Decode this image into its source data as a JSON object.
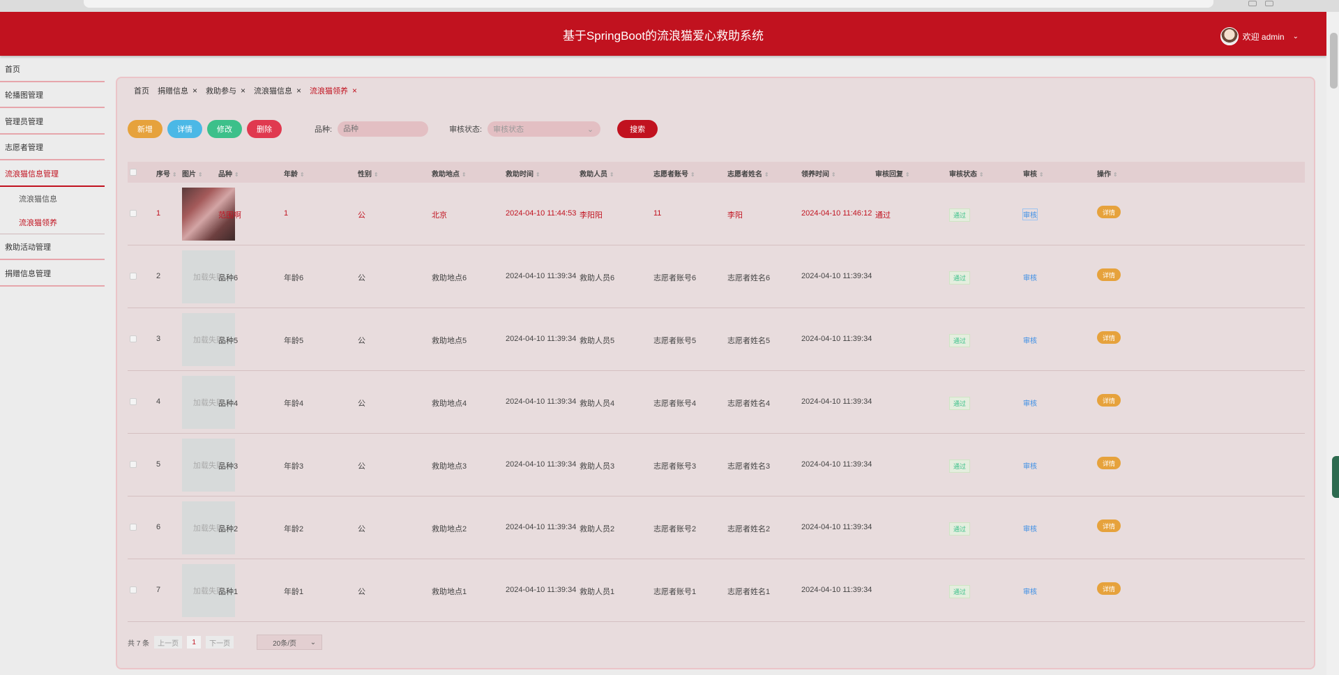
{
  "header": {
    "title": "基于SpringBoot的流浪猫爱心救助系统",
    "welcome": "欢迎 admin"
  },
  "sidebar": {
    "items": [
      {
        "label": "首页"
      },
      {
        "label": "轮播图管理"
      },
      {
        "label": "管理员管理"
      },
      {
        "label": "志愿者管理"
      },
      {
        "label": "流浪猫信息管理"
      },
      {
        "label": "救助活动管理"
      },
      {
        "label": "捐赠信息管理"
      }
    ],
    "sub_items": [
      {
        "label": "流浪猫信息"
      },
      {
        "label": "流浪猫领养"
      }
    ]
  },
  "tabs": [
    {
      "label": "首页"
    },
    {
      "label": "捐赠信息"
    },
    {
      "label": "救助参与"
    },
    {
      "label": "流浪猫信息"
    },
    {
      "label": "流浪猫领养"
    }
  ],
  "toolbar": {
    "add": "新增",
    "detail": "详情",
    "edit": "修改",
    "delete": "删除",
    "breed_label": "品种:",
    "breed_placeholder": "品种",
    "status_label": "审核状态:",
    "status_placeholder": "审核状态",
    "search": "搜索"
  },
  "table": {
    "columns": [
      "序号",
      "图片",
      "品种",
      "年龄",
      "性别",
      "救助地点",
      "救助时间",
      "救助人员",
      "志愿者账号",
      "志愿者姓名",
      "领养时间",
      "审核回复",
      "审核状态",
      "审核",
      "操作"
    ],
    "load_failed": "加载失败",
    "pass_tag": "通过",
    "review_link": "审核",
    "detail_btn": "详情",
    "rows": [
      {
        "no": "1",
        "breed": "范围啊",
        "age": "1",
        "gender": "公",
        "place": "北京",
        "rescue_time": "2024-04-10 11:44:53",
        "rescuer": "李阳阳",
        "account": "11",
        "name": "李阳",
        "adopt_time": "2024-04-10 11:46:12",
        "reply": "通过"
      },
      {
        "no": "2",
        "breed": "品种6",
        "age": "年龄6",
        "gender": "公",
        "place": "救助地点6",
        "rescue_time": "2024-04-10 11:39:34",
        "rescuer": "救助人员6",
        "account": "志愿者账号6",
        "name": "志愿者姓名6",
        "adopt_time": "2024-04-10 11:39:34",
        "reply": ""
      },
      {
        "no": "3",
        "breed": "品种5",
        "age": "年龄5",
        "gender": "公",
        "place": "救助地点5",
        "rescue_time": "2024-04-10 11:39:34",
        "rescuer": "救助人员5",
        "account": "志愿者账号5",
        "name": "志愿者姓名5",
        "adopt_time": "2024-04-10 11:39:34",
        "reply": ""
      },
      {
        "no": "4",
        "breed": "品种4",
        "age": "年龄4",
        "gender": "公",
        "place": "救助地点4",
        "rescue_time": "2024-04-10 11:39:34",
        "rescuer": "救助人员4",
        "account": "志愿者账号4",
        "name": "志愿者姓名4",
        "adopt_time": "2024-04-10 11:39:34",
        "reply": ""
      },
      {
        "no": "5",
        "breed": "品种3",
        "age": "年龄3",
        "gender": "公",
        "place": "救助地点3",
        "rescue_time": "2024-04-10 11:39:34",
        "rescuer": "救助人员3",
        "account": "志愿者账号3",
        "name": "志愿者姓名3",
        "adopt_time": "2024-04-10 11:39:34",
        "reply": ""
      },
      {
        "no": "6",
        "breed": "品种2",
        "age": "年龄2",
        "gender": "公",
        "place": "救助地点2",
        "rescue_time": "2024-04-10 11:39:34",
        "rescuer": "救助人员2",
        "account": "志愿者账号2",
        "name": "志愿者姓名2",
        "adopt_time": "2024-04-10 11:39:34",
        "reply": ""
      },
      {
        "no": "7",
        "breed": "品种1",
        "age": "年龄1",
        "gender": "公",
        "place": "救助地点1",
        "rescue_time": "2024-04-10 11:39:34",
        "rescuer": "救助人员1",
        "account": "志愿者账号1",
        "name": "志愿者姓名1",
        "adopt_time": "2024-04-10 11:39:34",
        "reply": ""
      }
    ]
  },
  "pager": {
    "total": "共 7 条",
    "prev": "上一页",
    "page": "1",
    "next": "下一页",
    "size": "20条/页"
  }
}
